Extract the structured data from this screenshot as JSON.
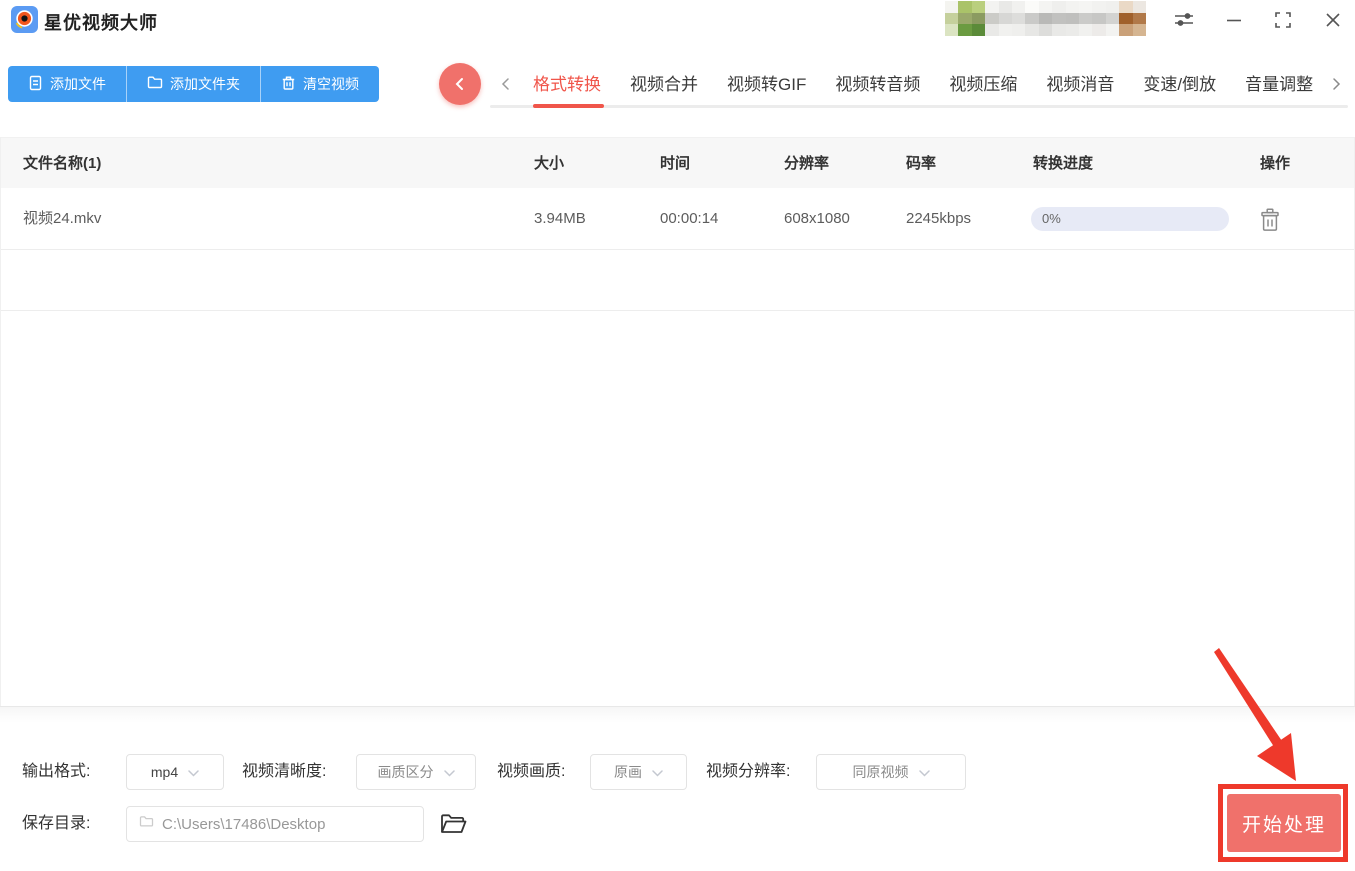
{
  "app": {
    "title": "星优视频大师"
  },
  "titlebar": {
    "user_blur_colors": [
      "#f4f4f0",
      "#aac369",
      "#bacf7e",
      "#f3f3f1",
      "#e9e9e7",
      "#f1f1ef",
      "#fbfbf9",
      "#f4f4f2",
      "#efefed",
      "#f3f3f1",
      "#f5f5f3",
      "#f2f2f0",
      "#f0f0ee",
      "#ead9c6",
      "#ece7e1",
      "#c5d09c",
      "#9aa96b",
      "#8b9b61",
      "#cbcbc7",
      "#d7d7d5",
      "#dddddb",
      "#cacac8",
      "#b9b9b7",
      "#c1c1bf",
      "#bfbfbd",
      "#cbcbc9",
      "#c7c7c5",
      "#d3d3d1",
      "#a0602b",
      "#b17949",
      "#dbe4c2",
      "#6b9b41",
      "#5b8b39",
      "#e9e9e7",
      "#f1f1ef",
      "#efefed",
      "#e7e7e5",
      "#dddddb",
      "#e9e9e7",
      "#ebebe9",
      "#f1f1ef",
      "#edebe9",
      "#f3f3f1",
      "#caa179",
      "#d5b591"
    ]
  },
  "toolbar": {
    "add_file": "添加文件",
    "add_folder": "添加文件夹",
    "clear_videos": "清空视频"
  },
  "tabs": {
    "items": [
      {
        "label": "格式转换",
        "active": true
      },
      {
        "label": "视频合并",
        "active": false
      },
      {
        "label": "视频转GIF",
        "active": false
      },
      {
        "label": "视频转音频",
        "active": false
      },
      {
        "label": "视频压缩",
        "active": false
      },
      {
        "label": "视频消音",
        "active": false
      },
      {
        "label": "变速/倒放",
        "active": false
      },
      {
        "label": "音量调整",
        "active": false
      }
    ]
  },
  "table": {
    "headers": {
      "name": "文件名称(1)",
      "size": "大小",
      "duration": "时间",
      "resolution": "分辨率",
      "bitrate": "码率",
      "progress": "转换进度",
      "action": "操作"
    },
    "rows": [
      {
        "name": "视频24.mkv",
        "size": "3.94MB",
        "duration": "00:00:14",
        "resolution": "608x1080",
        "bitrate": "2245kbps",
        "progress_label": "0%",
        "progress_percent": 0
      }
    ]
  },
  "settings": {
    "output_format": {
      "label": "输出格式:",
      "value": "mp4"
    },
    "clarity": {
      "label": "视频清晰度:",
      "value": "画质区分"
    },
    "quality": {
      "label": "视频画质:",
      "value": "原画"
    },
    "resolution": {
      "label": "视频分辨率:",
      "value": "同原视频"
    },
    "save_dir": {
      "label": "保存目录:",
      "value": "C:\\Users\\17486\\Desktop"
    }
  },
  "actions": {
    "start": "开始处理"
  },
  "colors": {
    "primary_blue": "#3f9cf1",
    "accent_coral": "#f0716b",
    "tab_active_red": "#f0554a",
    "annotation_red": "#ee392b",
    "progress_track": "#e7eaf6"
  }
}
